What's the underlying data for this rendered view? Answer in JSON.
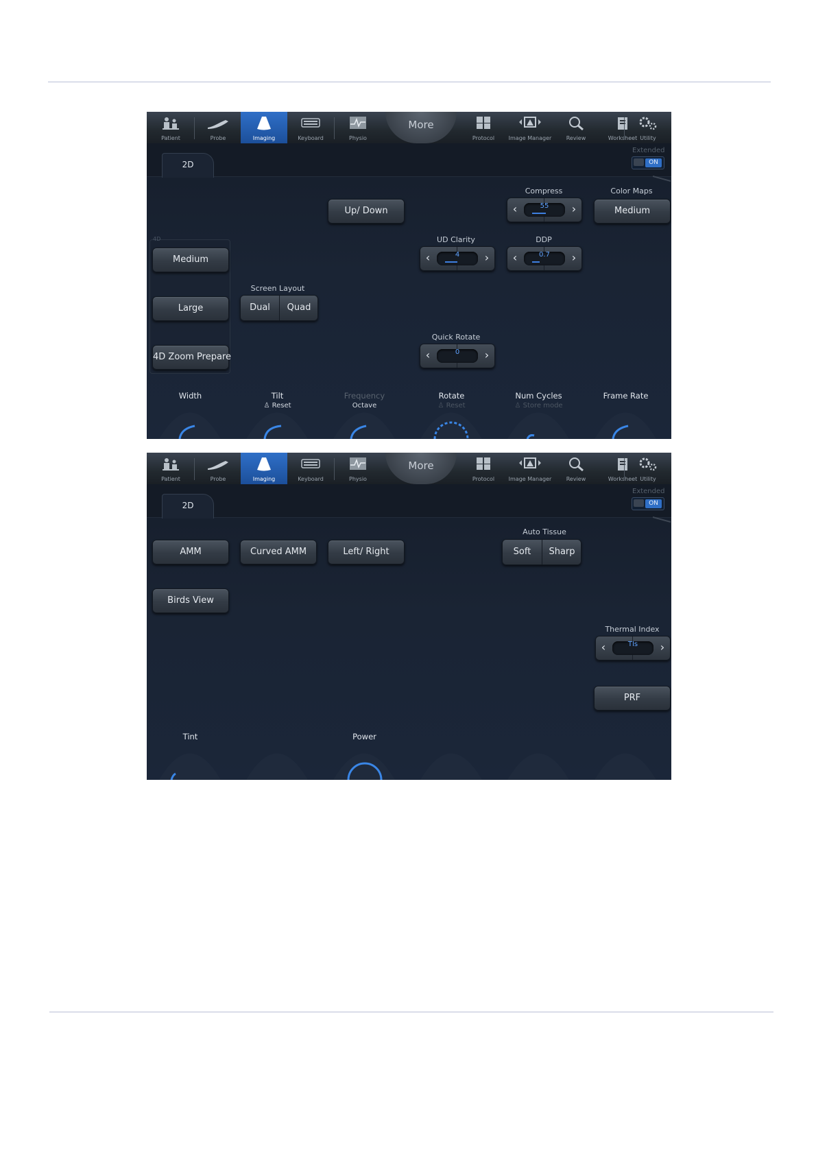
{
  "top_nav": {
    "items": [
      {
        "id": "patient",
        "label": "Patient",
        "icon": "patient-icon"
      },
      {
        "id": "probe",
        "label": "Probe",
        "icon": "probe-icon"
      },
      {
        "id": "imaging",
        "label": "Imaging",
        "icon": "imaging-icon",
        "active": true
      },
      {
        "id": "keyboard",
        "label": "Keyboard",
        "icon": "keyboard-icon"
      },
      {
        "id": "physio",
        "label": "Physio",
        "icon": "physio-icon"
      },
      {
        "id": "protocol",
        "label": "Protocol",
        "icon": "protocol-icon"
      },
      {
        "id": "image_manager",
        "label": "Image Manager",
        "icon": "image-manager-icon"
      },
      {
        "id": "review",
        "label": "Review",
        "icon": "review-icon"
      },
      {
        "id": "worksheet",
        "label": "Worksheet",
        "icon": "worksheet-icon"
      },
      {
        "id": "utility",
        "label": "Utility",
        "icon": "utility-icon"
      }
    ],
    "more_label": "More"
  },
  "colors": {
    "accent": "#2f6fc7",
    "value_text": "#5fa2ff",
    "bg": "#1a2434"
  },
  "screen1": {
    "tab": "2D",
    "extended_label": "Extended",
    "extended_state": "ON",
    "panel_tag": "4D",
    "buttons": {
      "up_down": "Up/ Down",
      "color_maps_value": "Medium",
      "medium": "Medium",
      "large": "Large",
      "zoom_prepare": "4D Zoom Prepare"
    },
    "labels": {
      "compress": "Compress",
      "color_maps": "Color Maps",
      "ud_clarity": "UD Clarity",
      "ddp": "DDP",
      "screen_layout": "Screen Layout",
      "quick_rotate": "Quick Rotate"
    },
    "values": {
      "compress": "55",
      "ud_clarity": "4",
      "ddp": "0.7",
      "quick_rotate": "0"
    },
    "value_levels": {
      "compress": 0.55,
      "ud_clarity": 0.5,
      "ddp": 0.3,
      "quick_rotate": 0
    },
    "screen_layout": {
      "left": "Dual",
      "right": "Quad"
    },
    "knobs": [
      {
        "label": "Width",
        "sub": "",
        "enabled": true
      },
      {
        "label": "Tilt",
        "sub": "Reset",
        "enabled": true
      },
      {
        "label": "Frequency",
        "sub": "Octave",
        "enabled": false,
        "sub_enabled": true
      },
      {
        "label": "Rotate",
        "sub": "Reset",
        "enabled": true,
        "sub_enabled": false
      },
      {
        "label": "Num Cycles",
        "sub": "Store mode",
        "enabled": true,
        "sub_enabled": false
      },
      {
        "label": "Frame Rate",
        "sub": "",
        "enabled": true
      }
    ]
  },
  "screen2": {
    "tab": "2D",
    "extended_label": "Extended",
    "extended_state": "ON",
    "buttons": {
      "amm": "AMM",
      "curved_amm": "Curved AMM",
      "left_right": "Left/ Right",
      "birds_view": "Birds View",
      "prf": "PRF"
    },
    "labels": {
      "auto_tissue": "Auto Tissue",
      "thermal_index": "Thermal Index"
    },
    "auto_tissue": {
      "left": "Soft",
      "right": "Sharp"
    },
    "values": {
      "thermal_index": "TIs"
    },
    "knobs": [
      {
        "label": "Tint",
        "sub": ""
      },
      {
        "label": "",
        "sub": ""
      },
      {
        "label": "Power",
        "sub": ""
      },
      {
        "label": "",
        "sub": ""
      },
      {
        "label": "",
        "sub": ""
      },
      {
        "label": "",
        "sub": ""
      }
    ]
  }
}
